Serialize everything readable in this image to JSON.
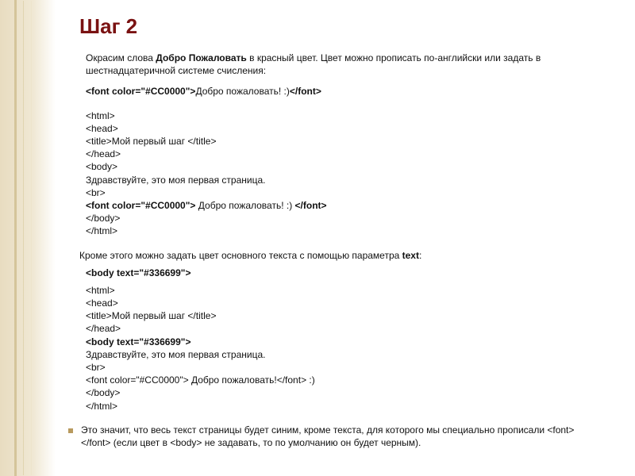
{
  "title": "Шаг 2",
  "intro_before": "Окрасим слова ",
  "intro_bold": "Добро Пожаловать",
  "intro_after": " в красный цвет.  Цвет можно прописать по-английски или задать в шестнадцатеричной системе счисления:",
  "example_line_pre": "<font color=\"#CC0000\">",
  "example_line_mid": "Добро пожаловать! :)",
  "example_line_post": "</font>",
  "code1": {
    "l1": "<html>",
    "l2": "<head>",
    "l3": "<title>Мой первый шаг </title>",
    "l4": "</head>",
    "l5": "<body>",
    "l6": "Здравствуйте, это моя первая страница.",
    "l7": "<br>",
    "l8a": "<font color=\"#CC0000\">",
    "l8b": " Добро пожаловать! :) ",
    "l8c": "</font>",
    "l9": "</body>",
    "l10": "</html>"
  },
  "para2_before": "Кроме этого можно задать цвет основного текста с помощью параметра ",
  "para2_bold": "text",
  "para2_after": ":",
  "body_example": "<body text=\"#336699\">",
  "code2": {
    "l1": "<html>",
    "l2": "<head>",
    "l3": "<title>Мой первый шаг </title>",
    "l4": "</head>",
    "l5": "<body text=\"#336699\">",
    "l6": "Здравствуйте, это моя первая страница.",
    "l7": "<br>",
    "l8": "<font color=\"#CC0000\"> Добро пожаловать!</font> :)",
    "l9": "</body>",
    "l10": "</html>"
  },
  "bullet_text": "Это значит, что весь текст страницы будет синим, кроме текста, для которого мы специально прописали <font></font> (если цвет в <body> не задавать, то по умолчанию он будет черным)."
}
